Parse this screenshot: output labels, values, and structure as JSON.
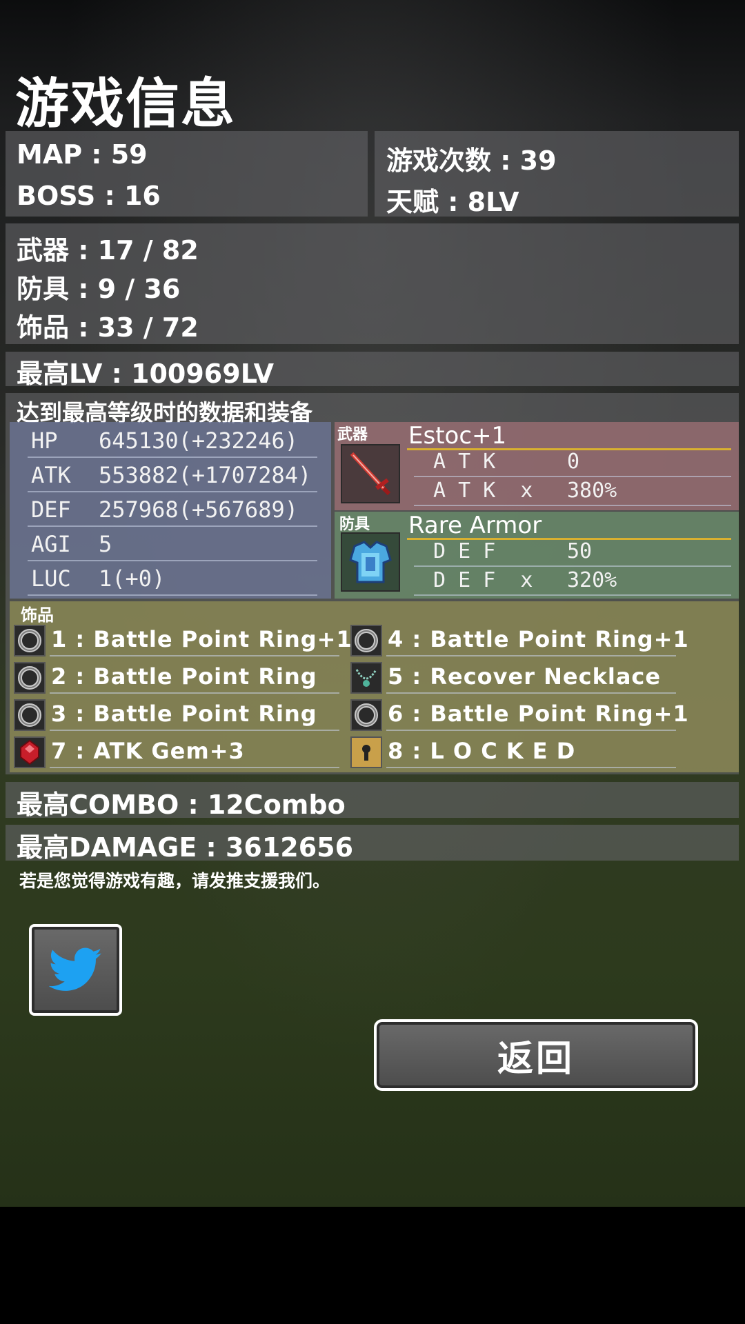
{
  "screen": {
    "title": "游戏信息"
  },
  "summary": {
    "map": "MAP : 59",
    "boss": "BOSS : 16",
    "play_count": "游戏次数 : 39",
    "talent": "天赋 : 8LV"
  },
  "collection": {
    "weapons": "武器 : 17 / 82",
    "armor": "防具 : 9 / 36",
    "accessories": "饰品 : 33 / 72"
  },
  "max_level": "最高LV : 100969LV",
  "best_section": {
    "header": "达到最高等级时的数据和装备",
    "stats": [
      {
        "label": "HP",
        "value": "645130(+232246)"
      },
      {
        "label": "ATK",
        "value": "553882(+1707284)"
      },
      {
        "label": "DEF",
        "value": "257968(+567689)"
      },
      {
        "label": "AGI",
        "value": "5"
      },
      {
        "label": "LUC",
        "value": "1(+0)"
      }
    ],
    "weapon": {
      "tag": "武器",
      "name": "Estoc+1",
      "lines": [
        {
          "label": "A T K",
          "value": "0"
        },
        {
          "label": "A T K  x",
          "value": "380%"
        }
      ],
      "icon": "sword-icon"
    },
    "armor": {
      "tag": "防具",
      "name": "Rare Armor",
      "lines": [
        {
          "label": "D E F",
          "value": "50"
        },
        {
          "label": "D E F  x",
          "value": "320%"
        }
      ],
      "icon": "armor-icon"
    },
    "accessories": {
      "tag": "饰品",
      "items": [
        {
          "text": "1 : Battle Point Ring+1",
          "icon": "ring-icon"
        },
        {
          "text": "2 : Battle Point Ring",
          "icon": "ring-icon"
        },
        {
          "text": "3 : Battle Point Ring",
          "icon": "ring-icon"
        },
        {
          "text": "7 : ATK Gem+3",
          "icon": "gem-icon"
        },
        {
          "text": "4 : Battle Point Ring+1",
          "icon": "ring-icon"
        },
        {
          "text": "5 : Recover Necklace",
          "icon": "necklace-icon"
        },
        {
          "text": "6 : Battle Point Ring+1",
          "icon": "ring-icon"
        },
        {
          "text": "8 : L O C K E D",
          "icon": "lock-icon"
        }
      ]
    }
  },
  "max_combo": "最高COMBO : 12Combo",
  "max_damage": "最高DAMAGE : 3612656",
  "support_text": "若是您觉得游戏有趣，请发推支援我们。",
  "buttons": {
    "twitter_icon": "twitter-bird-icon",
    "back_label": "返回"
  },
  "colors": {
    "weapon_panel": "#9c6e73",
    "armor_panel": "#6a8e6b",
    "stats_panel": "#6e7799",
    "accessory_panel": "#8c8a54",
    "twitter_blue": "#1da1f2",
    "gold_rule": "#d8b030"
  }
}
